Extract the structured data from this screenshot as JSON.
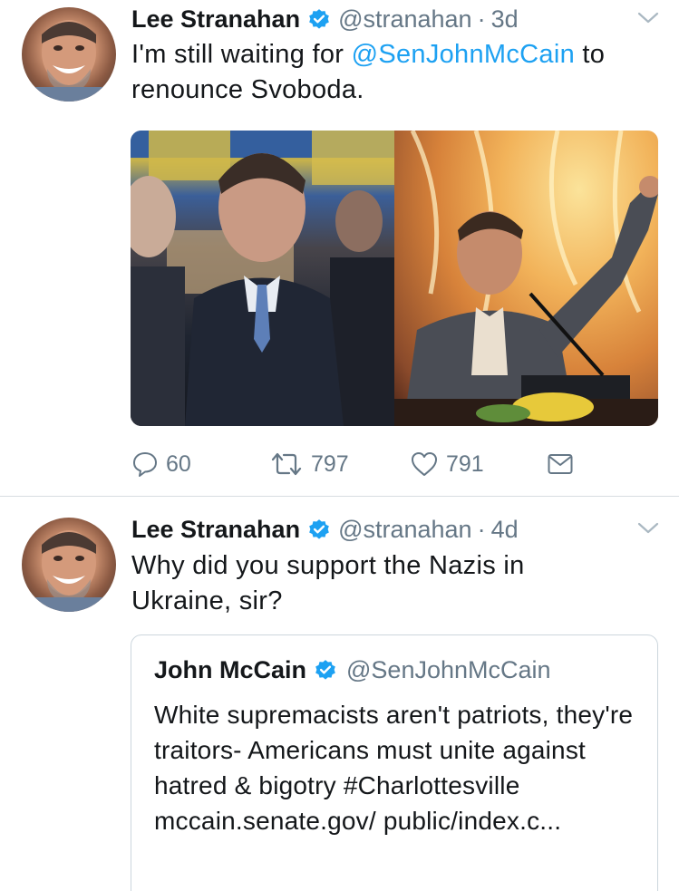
{
  "tweets": [
    {
      "author": {
        "name": "Lee Stranahan",
        "handle": "@stranahan",
        "verified": true
      },
      "separator": "·",
      "time": "3d",
      "text_before": "I'm still waiting for ",
      "mention": "@SenJohnMcCain",
      "text_after": " to renounce Svoboda.",
      "media": {
        "type": "photo-collage",
        "images": 2
      },
      "actions": {
        "reply_count": "60",
        "retweet_count": "797",
        "like_count": "791"
      }
    },
    {
      "author": {
        "name": "Lee Stranahan",
        "handle": "@stranahan",
        "verified": true
      },
      "separator": "·",
      "time": "4d",
      "text": "Why did you support the Nazis in Ukraine, sir?",
      "quoted_tweet": {
        "author": {
          "name": "John McCain",
          "handle": "@SenJohnMcCain",
          "verified": true
        },
        "text": "White supremacists aren't patriots, they're traitors- Americans must unite against hatred & bigotry #Charlottesville mccain.senate.gov/ public/index.c..."
      }
    }
  ],
  "icons": {
    "verified": "verified-badge-icon",
    "menu": "chevron-down-icon",
    "reply": "reply-icon",
    "retweet": "retweet-icon",
    "like": "heart-icon",
    "dm": "envelope-icon"
  },
  "colors": {
    "text": "#14171a",
    "secondary": "#657786",
    "link": "#1da1f2",
    "verified": "#1da1f2",
    "divider": "#d8dde1"
  }
}
